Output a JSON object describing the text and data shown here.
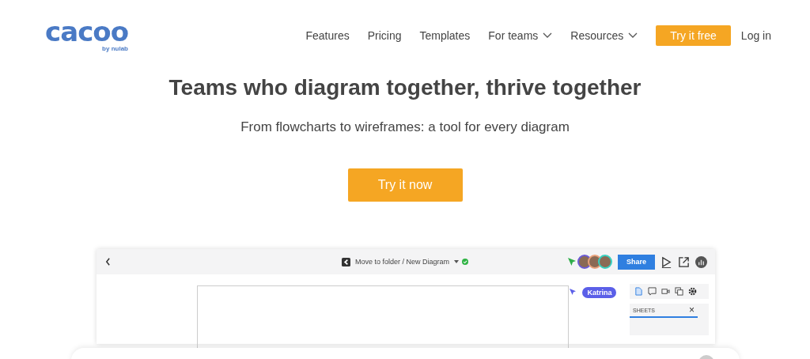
{
  "logo": {
    "name": "cacoo",
    "tagline": "by nulab"
  },
  "nav": {
    "items": [
      {
        "label": "Features",
        "dropdown": false
      },
      {
        "label": "Pricing",
        "dropdown": false
      },
      {
        "label": "Templates",
        "dropdown": false
      },
      {
        "label": "For teams",
        "dropdown": true
      },
      {
        "label": "Resources",
        "dropdown": true
      }
    ],
    "cta": "Try it free",
    "login": "Log in"
  },
  "hero": {
    "title": "Teams who diagram together, thrive together",
    "subtitle": "From flowcharts to wireframes: a tool for every diagram",
    "button": "Try it now"
  },
  "preview": {
    "breadcrumb": "Move to folder / New Diagram",
    "saved": true,
    "avatars": [
      {
        "color": "#6b5bd6"
      },
      {
        "color": "#e8a27c"
      },
      {
        "color": "#3ad1c0"
      }
    ],
    "share": "Share",
    "cursor_label": "Katrina",
    "panel_title": "SHEETS",
    "panel_close": "×"
  }
}
